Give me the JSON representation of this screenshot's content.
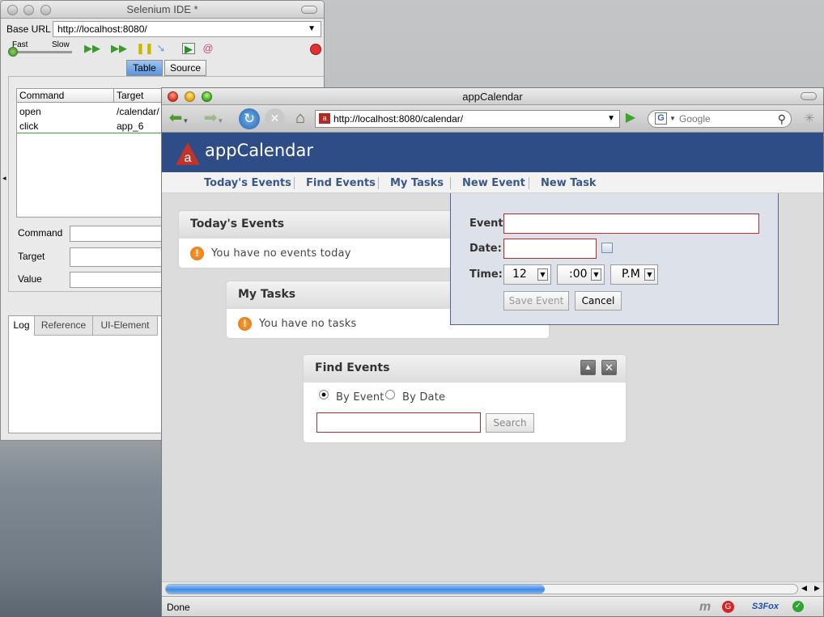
{
  "selenium": {
    "window_title": "Selenium IDE *",
    "base_url_label": "Base URL",
    "base_url_value": "http://localhost:8080/",
    "speed_fast": "Fast",
    "speed_slow": "Slow",
    "tabs": {
      "table": "Table",
      "source": "Source"
    },
    "columns": {
      "command": "Command",
      "target": "Target"
    },
    "rows": [
      {
        "command": "open",
        "target": "/calendar/"
      },
      {
        "command": "click",
        "target": "app_6"
      }
    ],
    "fields": {
      "command": "Command",
      "target": "Target",
      "value": "Value"
    },
    "bottom_tabs": {
      "log": "Log",
      "reference": "Reference",
      "ui_element": "UI-Element"
    }
  },
  "browser": {
    "window_title": "appCalendar",
    "url": "http://localhost:8080/calendar/",
    "search_placeholder": "Google",
    "status": "Done",
    "status_s3fox": "S3Fox"
  },
  "app": {
    "title": "appCalendar",
    "logo_letter": "a",
    "nav": [
      "Today's Events",
      "Find Events",
      "My Tasks",
      "New Event",
      "New Task"
    ]
  },
  "todays_events": {
    "title": "Today's Events",
    "message": "You have no events today"
  },
  "my_tasks": {
    "title": "My Tasks",
    "message": "You have no tasks"
  },
  "find_events": {
    "title": "Find Events",
    "by_event": "By Event",
    "by_date": "By Date",
    "search_button": "Search"
  },
  "new_event": {
    "event_label": "Event:",
    "date_label": "Date:",
    "time_label": "Time:",
    "hour": "12",
    "minute": ":00",
    "ampm": "P.M",
    "save_button": "Save Event",
    "cancel_button": "Cancel"
  },
  "colors": {
    "app_header": "#2e4d86",
    "nav_link": "#39578c",
    "invalid_border": "#c0282b",
    "progress": "#3f8ae6"
  },
  "progress": {
    "loaded": 0.6
  }
}
